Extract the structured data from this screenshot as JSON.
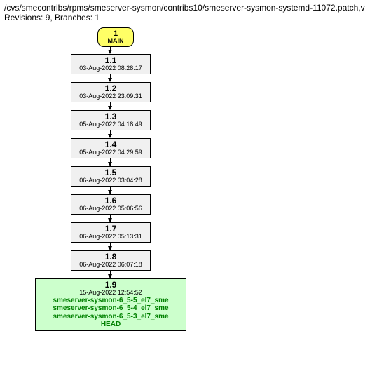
{
  "header": {
    "path": "/cvs/smecontribs/rpms/smeserver-sysmon/contribs10/smeserver-sysmon-systemd-11072.patch,v",
    "meta": "Revisions: 9, Branches: 1"
  },
  "main": {
    "number": "1",
    "label": "MAIN"
  },
  "revisions": [
    {
      "rev": "1.1",
      "date": "03-Aug-2022 08:28:17"
    },
    {
      "rev": "1.2",
      "date": "03-Aug-2022 23:09:31"
    },
    {
      "rev": "1.3",
      "date": "05-Aug-2022 04:18:49"
    },
    {
      "rev": "1.4",
      "date": "05-Aug-2022 04:29:59"
    },
    {
      "rev": "1.5",
      "date": "06-Aug-2022 03:04:28"
    },
    {
      "rev": "1.6",
      "date": "06-Aug-2022 05:06:56"
    },
    {
      "rev": "1.7",
      "date": "06-Aug-2022 05:13:31"
    },
    {
      "rev": "1.8",
      "date": "06-Aug-2022 06:07:18"
    }
  ],
  "tagged": {
    "rev": "1.9",
    "date": "15-Aug-2022 12:54:52",
    "tags": [
      "smeserver-sysmon-6_5-5_el7_sme",
      "smeserver-sysmon-6_5-4_el7_sme",
      "smeserver-sysmon-6_5-3_el7_sme",
      "HEAD"
    ]
  }
}
